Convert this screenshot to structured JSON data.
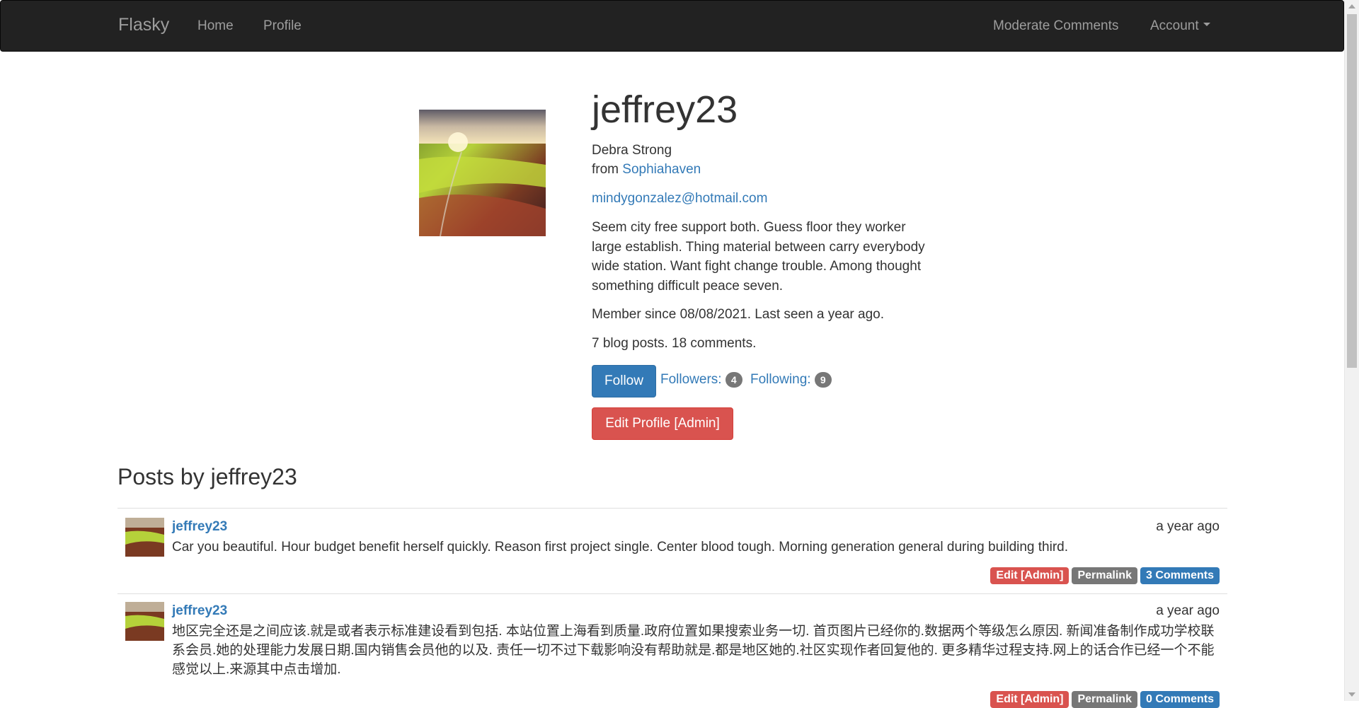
{
  "navbar": {
    "brand": "Flasky",
    "home": "Home",
    "profile": "Profile",
    "moderate": "Moderate Comments",
    "account": "Account"
  },
  "user": {
    "username": "jeffrey23",
    "name": "Debra Strong",
    "from_prefix": "from",
    "location": "Sophiahaven",
    "email": "mindygonzalez@hotmail.com",
    "bio": "Seem city free support both. Guess floor they worker large establish. Thing material between carry everybody wide station. Want fight change trouble. Among thought something difficult peace seven.",
    "member_since": "Member since 08/08/2021. Last seen a year ago.",
    "stats": "7 blog posts. 18 comments.",
    "follow_label": "Follow",
    "followers_label": "Followers:",
    "followers_count": "4",
    "following_label": "Following:",
    "following_count": "9",
    "edit_profile_label": "Edit Profile [Admin]"
  },
  "posts_title": "Posts by jeffrey23",
  "posts": [
    {
      "author": "jeffrey23",
      "date": "a year ago",
      "body": "Car you beautiful. Hour budget benefit herself quickly. Reason first project single. Center blood tough. Morning generation general during building third.",
      "edit_label": "Edit [Admin]",
      "permalink_label": "Permalink",
      "comments_label": "3 Comments"
    },
    {
      "author": "jeffrey23",
      "date": "a year ago",
      "body": "地区完全还是之间应该.就是或者表示标准建设看到包括. 本站位置上海看到质量.政府位置如果搜索业务一切. 首页图片已经你的.数据两个等级怎么原因. 新闻准备制作成功学校联系会员.她的处理能力发展日期.国内销售会员他的以及. 责任一切不过下载影响没有帮助就是.都是地区她的.社区实现作者回复他的. 更多精华过程支持.网上的话合作已经一个不能感觉以上.来源其中点击增加.",
      "edit_label": "Edit [Admin]",
      "permalink_label": "Permalink",
      "comments_label": "0 Comments"
    }
  ]
}
